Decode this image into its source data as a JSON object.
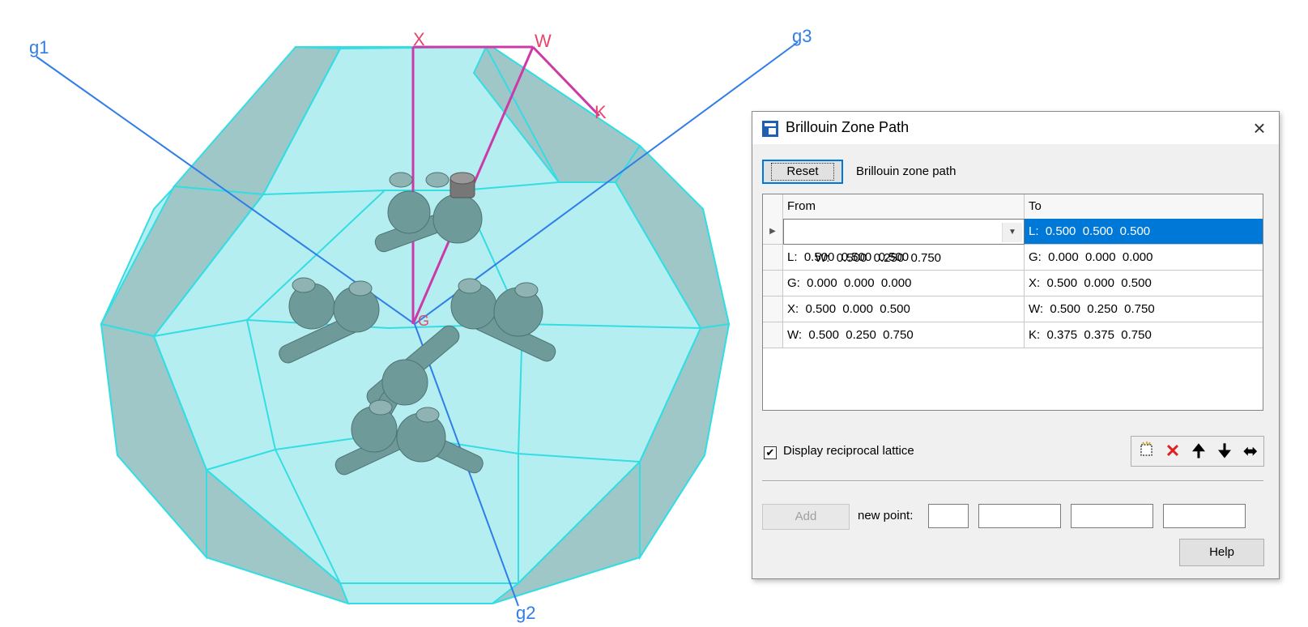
{
  "scene": {
    "labels": {
      "g1": "g1",
      "g2": "g2",
      "g3": "g3",
      "x": "X",
      "w": "W",
      "k": "K",
      "g": "G"
    }
  },
  "dialog": {
    "title": "Brillouin Zone Path",
    "close": "×",
    "reset_label": "Reset",
    "path_label": "Brillouin zone path",
    "columns": {
      "from": "From",
      "to": "To"
    },
    "rows": [
      {
        "from": "W:  0.500  0.250  0.750",
        "to": "L:  0.500  0.500  0.500"
      },
      {
        "from": "L:  0.500  0.500  0.500",
        "to": "G:  0.000  0.000  0.000"
      },
      {
        "from": "G:  0.000  0.000  0.000",
        "to": "X:  0.500  0.000  0.500"
      },
      {
        "from": "X:  0.500  0.000  0.500",
        "to": "W:  0.500  0.250  0.750"
      },
      {
        "from": "W:  0.500  0.250  0.750",
        "to": "K:  0.375  0.375  0.750"
      }
    ],
    "display_reciprocal_label": "Display reciprocal lattice",
    "display_reciprocal_checked": "✔",
    "toolbar": {
      "new_icon": "new-row-icon",
      "delete_icon": "delete-icon",
      "up_icon": "arrow-up-icon",
      "down_icon": "arrow-down-icon",
      "swap_icon": "swap-icon"
    },
    "add_label": "Add",
    "new_point_label": "new point:",
    "new_point_values": [
      "",
      "",
      "",
      ""
    ],
    "help_label": "Help"
  },
  "colors": {
    "zone_face": "#b4eef0",
    "zone_edge": "#33dde4",
    "vector": "#2f7de8",
    "path": "#cc3aa8",
    "atom": "#6f9a9a",
    "selection": "#0078d7"
  }
}
